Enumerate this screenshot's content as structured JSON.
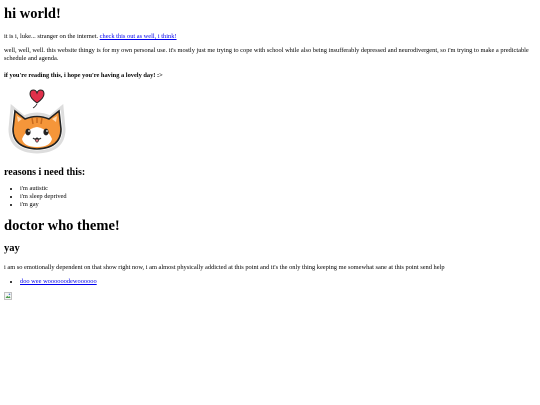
{
  "page": {
    "title": "hi world!",
    "intro_text": "it is i, luke... stranger on the internet. ",
    "intro_link": "check this out as well, i think!",
    "description": "well, well, well. this website thingy is for my own personal use. it's mostly just me trying to cope with school while also being insufferably depressed and neurodivergent, so i'm trying to make a predictable schedule and agenda.",
    "hope": "if you're reading this, i hope you're having a lovely day! :>",
    "cat_image": "cat-with-heart-icon"
  },
  "reasons": {
    "heading": "reasons i need this:",
    "items": [
      "i'm autistic",
      "i'm sleep deprived",
      "i'm gay"
    ]
  },
  "doctor_who": {
    "heading": "doctor who theme!",
    "subheading": "yay",
    "text": "i am so emotionally dependent on that show right now, i am almost physically addicted at this point and it's the only thing keeping me somewhat sane at this point send help",
    "links": [
      "doo wee woooooodewoooooo"
    ],
    "broken_image": "broken-image-icon"
  },
  "colors": {
    "link": "#0000ee",
    "cat_orange": "#f5963a",
    "heart": "#e0304a"
  }
}
